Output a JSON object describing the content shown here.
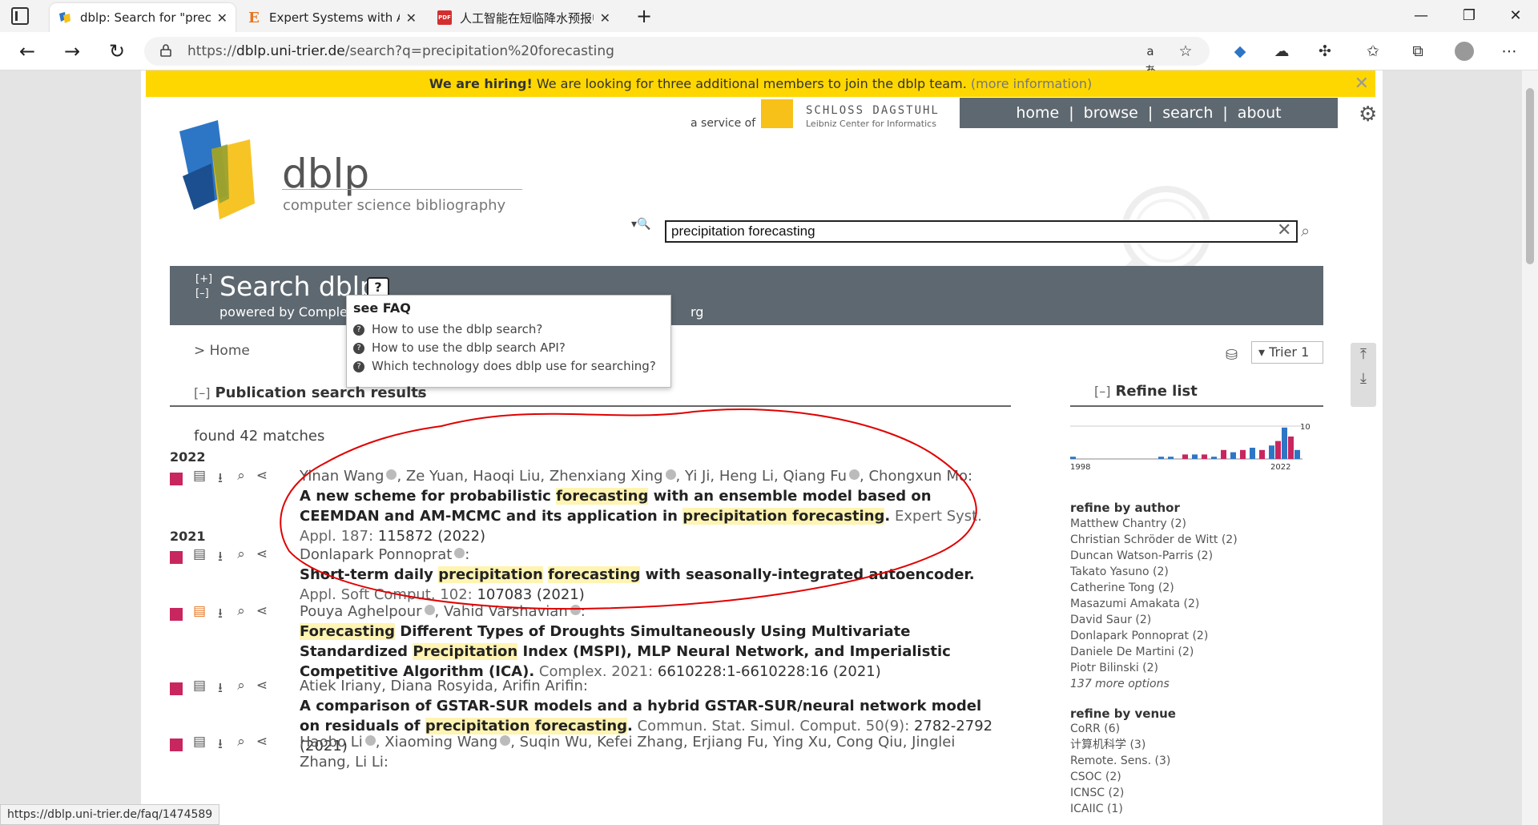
{
  "browser": {
    "tabs": [
      {
        "title": "dblp: Search for \"precipitation fo",
        "favicon": "dblp-logo"
      },
      {
        "title": "Expert Systems with Applications",
        "favicon": "elsevier-E"
      },
      {
        "title": "人工智能在短临降水预报中应用",
        "favicon": "pdf-icon"
      }
    ],
    "url_prefix": "https://",
    "url_host": "dblp.uni-trier.de",
    "url_rest": "/search?q=precipitation%20forecasting",
    "status_url": "https://dblp.uni-trier.de/faq/1474589"
  },
  "banner": {
    "bold": "We are hiring!",
    "text": " We are looking for three additional members to join the dblp team. ",
    "more": "(more information)"
  },
  "header": {
    "service_of": "a service of",
    "dagstuhl_name": "SCHLOSS DAGSTUHL",
    "dagstuhl_sub": "Leibniz Center for Informatics",
    "nav": [
      "home",
      "browse",
      "search",
      "about"
    ],
    "logo_title": "dblp",
    "logo_subtitle": "computer science bibliography"
  },
  "search": {
    "query": "precipitation forecasting",
    "title": "Search dblp",
    "powered_by": "powered by Complet",
    "powered_rest": "rg",
    "expand": "[+]",
    "collapse": "[–]"
  },
  "faq": {
    "head": "see FAQ",
    "items": [
      "How to use the dblp search?",
      "How to use the dblp search API?",
      "Which technology does dblp use for searching?"
    ]
  },
  "breadcrumb": "> Home",
  "mirror": "Trier 1",
  "results": {
    "header": "Publication search results",
    "found": "found 42 matches",
    "years": [
      "2022",
      "2021"
    ]
  },
  "entries": [
    {
      "authors": [
        "Yinan Wang",
        "Ze Yuan",
        "Haoqi Liu",
        "Zhenxiang Xing",
        "Yi Ji",
        "Heng Li",
        "Qiang Fu",
        "Chongxun Mo"
      ],
      "title_parts": [
        "A new scheme for probabilistic ",
        "forecasting",
        " with an ensemble model based on CEEMDAN and AM-MCMC and its application in ",
        "precipitation",
        " ",
        "forecasting",
        "."
      ],
      "venue": " Expert Syst. Appl. 187: ",
      "venue_num": "115872 (2022)"
    },
    {
      "authors": [
        "Donlapark Ponnoprat"
      ],
      "title_parts": [
        "Short-term daily ",
        "precipitation",
        " ",
        "forecasting",
        " with seasonally-integrated autoencoder."
      ],
      "venue": " Appl. Soft Comput. 102: ",
      "venue_num": "107083 (2021)"
    },
    {
      "authors": [
        "Pouya Aghelpour",
        "Vahid Varshavian"
      ],
      "title_parts": [
        "Forecasting",
        " Different Types of Droughts Simultaneously Using Multivariate Standardized ",
        "Precipitation",
        " Index (MSPI), MLP Neural Network, and Imperialistic Competitive Algorithm (ICA)."
      ],
      "venue": " Complex. 2021: ",
      "venue_num": "6610228:1-6610228:16 (2021)"
    },
    {
      "authors": [
        "Atiek Iriany",
        "Diana Rosyida",
        "Arifin Arifin"
      ],
      "title_parts": [
        "A comparison of GSTAR-SUR models and a hybrid GSTAR-SUR/neural network model on residuals of ",
        "precipitation",
        " ",
        "forecasting",
        "."
      ],
      "venue": " Commun. Stat. Simul. Comput. 50(9): ",
      "venue_num": "2782-2792 (2021)"
    },
    {
      "authors": [
        "Haobo Li",
        "Xiaoming Wang",
        "Suqin Wu",
        "Kefei Zhang",
        "Erjiang Fu",
        "Ying Xu",
        "Cong Qiu",
        "Jinglei Zhang",
        "Li Li"
      ],
      "title_parts": [],
      "venue": "",
      "venue_num": ""
    }
  ],
  "refine": {
    "title": "Refine list",
    "hist_start": "1998",
    "hist_end": "2022",
    "hist_max": "10",
    "author_head": "refine by author",
    "authors": [
      "Matthew Chantry (2)",
      "Christian Schröder de Witt (2)",
      "Duncan Watson-Parris (2)",
      "Takato Yasuno (2)",
      "Catherine Tong (2)",
      "Masazumi Amakata (2)",
      "David Saur (2)",
      "Donlapark Ponnoprat (2)",
      "Daniele De Martini (2)",
      "Piotr Bilinski (2)"
    ],
    "author_more": "137 more options",
    "venue_head": "refine by venue",
    "venues": [
      "CoRR (6)",
      "计算机科学 (3)",
      "Remote. Sens. (3)",
      "CSOC (2)",
      "ICNSC (2)",
      "ICAIIC (1)"
    ]
  },
  "colors": {
    "banner": "#ffd700",
    "nav_bg": "#5e6870",
    "highlight": "#fff4b2",
    "entry_marker": "#c8265f",
    "annotation": "#e00000"
  }
}
